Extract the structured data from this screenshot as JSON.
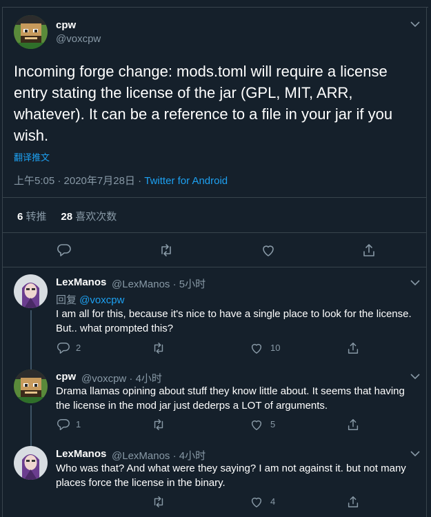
{
  "main_tweet": {
    "name": "cpw",
    "handle": "@voxcpw",
    "text": "Incoming forge change: mods.toml will require a license entry stating the license of the jar (GPL, MIT, ARR, whatever). It can be a reference to a file in your jar if you wish.",
    "translate": "翻译推文",
    "time": "上午5:05 · 2020年7月28日 · ",
    "source": "Twitter for Android",
    "retweets_count": "6",
    "retweets_label": "转推",
    "likes_count": "28",
    "likes_label": "喜欢次数"
  },
  "replies": [
    {
      "name": "LexManos",
      "handle_time": "@LexManos · 5小时",
      "reply_to_label": "回复 ",
      "reply_to": "@voxcpw",
      "text": "I am all for this, because it's nice to have a single place to look for the license. But.. what prompted this?",
      "reply_count": "2",
      "like_count": "10"
    },
    {
      "name": "cpw",
      "handle_time": "@voxcpw · 4小时",
      "text": "Drama llamas opining about stuff they know little about. It seems that having the license in the mod jar just dederps a LOT of arguments.",
      "reply_count": "1",
      "like_count": "5"
    },
    {
      "name": "LexManos",
      "handle_time": "@LexManos · 4小时",
      "text": "Who was that? And what were they saying? I am not against it. but not many places force the license in the binary.",
      "like_count": "4"
    }
  ],
  "icons": [
    "chevron-down-icon",
    "reply-icon",
    "retweet-icon",
    "like-icon",
    "share-icon"
  ],
  "colors": {
    "background": "#15202b",
    "accent": "#1da1f2",
    "muted": "#8899a6",
    "divider": "#38444d"
  }
}
